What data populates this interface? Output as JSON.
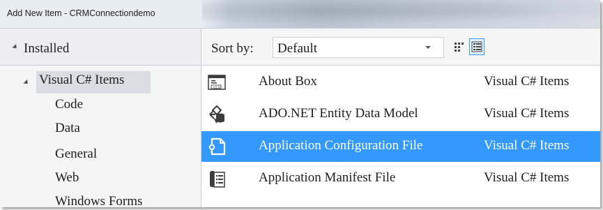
{
  "window": {
    "title": "Add New Item - CRMConnectiondemo"
  },
  "left_pane": {
    "installed_label": "Installed",
    "category": "Visual C# Items",
    "items": [
      {
        "label": "Code"
      },
      {
        "label": "Data"
      },
      {
        "label": "General"
      },
      {
        "label": "Web"
      },
      {
        "label": "Windows Forms"
      }
    ]
  },
  "toolbar": {
    "sort_label": "Sort by:",
    "sort_value": "Default",
    "view_modes": [
      "small-icons-view-icon",
      "details-view-icon"
    ]
  },
  "templates": [
    {
      "name": "About Box",
      "type": "Visual C# Items",
      "icon": "about-box-icon",
      "selected": false
    },
    {
      "name": "ADO.NET Entity Data Model",
      "type": "Visual C# Items",
      "icon": "entity-data-model-icon",
      "selected": false
    },
    {
      "name": "Application Configuration File",
      "type": "Visual C# Items",
      "icon": "config-file-icon",
      "selected": true
    },
    {
      "name": "Application Manifest File",
      "type": "Visual C# Items",
      "icon": "manifest-file-icon",
      "selected": false
    }
  ],
  "colors": {
    "selection": "#3399ff",
    "tree_selection": "#dcdce4",
    "pane_background": "#f5f5f5"
  }
}
